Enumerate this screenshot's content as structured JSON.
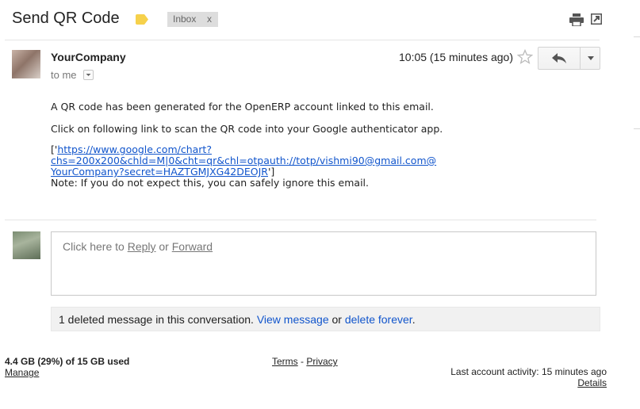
{
  "header": {
    "subject": "Send QR Code",
    "label_chip": "Inbox",
    "label_chip_close": "x",
    "label_color": "#f6d14b"
  },
  "message": {
    "sender": "YourCompany",
    "recipient_line": "to me",
    "time": "10:05 (15 minutes ago)",
    "paragraph1": "A QR code has been generated for the OpenERP account linked to this email.",
    "paragraph2": "Click on following link to scan the QR code into your Google authenticator app.",
    "link_prefix": "['",
    "link_line1": "https://www.google.com/chart?chs=200x200&chld=M|0&cht=qr&chl=otpauth://totp/vishmi90@gmail.com@",
    "link_line2": "YourCompany?secret=HAZTGMJXG42DEOJR",
    "link_suffix": "']",
    "note": "Note: If you do not expect this, you can safely ignore this email."
  },
  "reply_box": {
    "prefix": "Click here to ",
    "reply": "Reply",
    "middle": " or ",
    "forward": "Forward"
  },
  "deleted_notice": {
    "text": "1 deleted message in this conversation. ",
    "view": "View message",
    "or": " or ",
    "delete": "delete forever",
    "end": "."
  },
  "footer": {
    "storage": "4.4 GB (29%) of 15 GB used",
    "manage": "Manage",
    "terms": "Terms",
    "separator": " - ",
    "privacy": "Privacy",
    "last_activity": "Last account activity: 15 minutes ago",
    "details": "Details"
  },
  "icons": {
    "label": "label-tag-icon",
    "print": "print-icon",
    "new_window": "new-window-icon",
    "star": "star-icon",
    "reply": "reply-arrow-icon",
    "more": "chevron-down-icon"
  }
}
